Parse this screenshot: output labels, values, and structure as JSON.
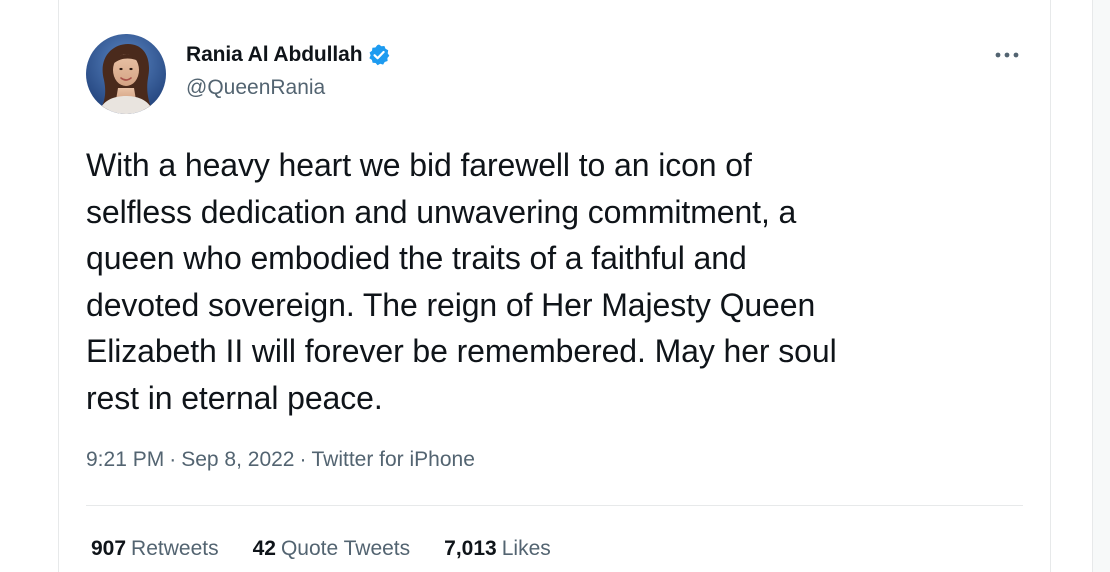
{
  "author": {
    "display_name": "Rania Al Abdullah",
    "handle": "@QueenRania",
    "verified": true,
    "avatar_icon": "profile-photo"
  },
  "menu": {
    "more_icon": "more-horizontal-icon"
  },
  "tweet": {
    "text": "With a heavy heart we bid farewell to an icon of\nselfless dedication and unwavering commitment, a\nqueen who embodied the traits of a faithful and\ndevoted sovereign. The reign of Her Majesty Queen\nElizabeth II will forever be remembered. May her soul\nrest in eternal peace."
  },
  "meta": {
    "time": "9:21 PM",
    "separator": "·",
    "date": "Sep 8, 2022",
    "source": "Twitter for iPhone"
  },
  "stats": {
    "retweets": {
      "count": "907",
      "label": "Retweets"
    },
    "quote_tweets": {
      "count": "42",
      "label": "Quote Tweets"
    },
    "likes": {
      "count": "7,013",
      "label": "Likes"
    }
  },
  "colors": {
    "primary_text": "#0f1419",
    "secondary_text": "#536471",
    "verified_blue": "#1d9bf0",
    "divider": "#e7e9ea"
  }
}
